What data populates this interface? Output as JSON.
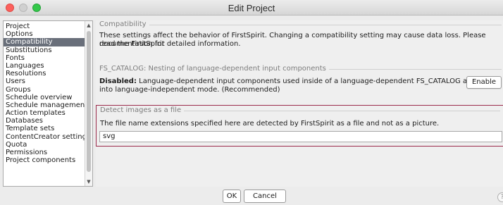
{
  "window": {
    "title": "Edit Project"
  },
  "sidebar": {
    "items": [
      {
        "label": "Project"
      },
      {
        "label": "Options"
      },
      {
        "label": "Compatibility",
        "selected": true
      },
      {
        "label": "Substitutions"
      },
      {
        "label": "Fonts"
      },
      {
        "label": "Languages"
      },
      {
        "label": "Resolutions"
      },
      {
        "label": "Users"
      },
      {
        "label": "Groups"
      },
      {
        "label": "Schedule overview"
      },
      {
        "label": "Schedule management"
      },
      {
        "label": "Action templates"
      },
      {
        "label": "Databases"
      },
      {
        "label": "Template sets"
      },
      {
        "label": "ContentCreator settings"
      },
      {
        "label": "Quota"
      },
      {
        "label": "Permissions"
      },
      {
        "label": "Project components"
      }
    ]
  },
  "compatibility": {
    "heading": "Compatibility",
    "description_line1": "These settings affect the behavior of FirstSpirit. Changing a compatibility setting may cause data loss. Please read the FirstSpirit",
    "description_line2": "documentation for detailed information."
  },
  "fs_catalog": {
    "heading": "FS_CATALOG: Nesting of language-dependent input components",
    "status": "Disabled:",
    "description_line1": " Language-dependent input components used inside of a language-dependent FS_CATALOG are forced",
    "description_line2": "into language-independent mode. (Recommended)",
    "button_label": "Enable"
  },
  "detect_images": {
    "heading": "Detect images as a file",
    "description": "The file name extensions specified here are detected by FirstSpirit as a file and not as a picture.",
    "input_value": "svg"
  },
  "footer": {
    "ok_label": "OK",
    "cancel_label": "Cancel",
    "help_glyph": "?"
  },
  "colors": {
    "selected_item_bg": "#696f7a",
    "highlight_border": "#9b2a4b",
    "close_button": "#fc605c",
    "maximize_button": "#34c84a"
  }
}
